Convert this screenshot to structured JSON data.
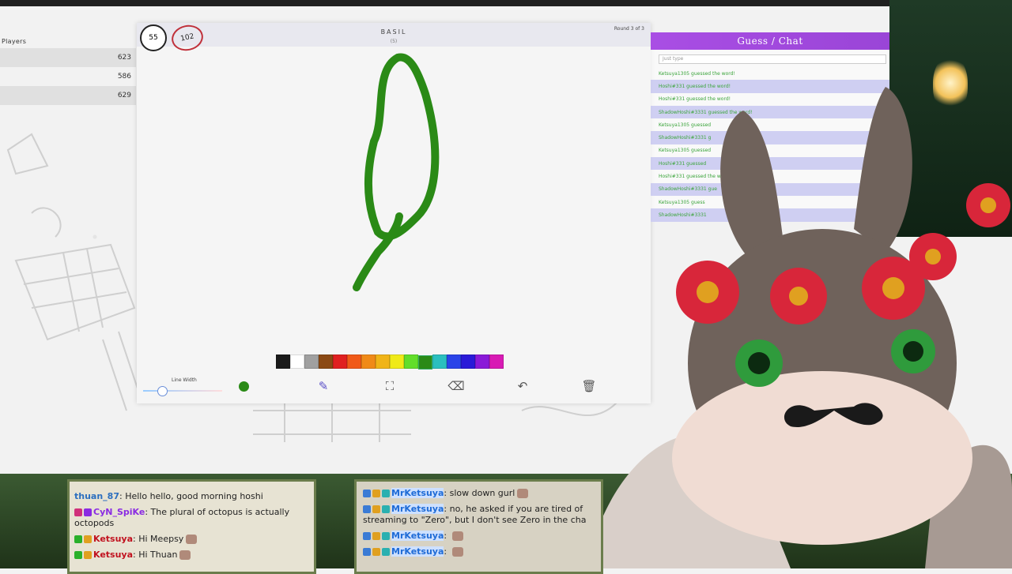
{
  "players": {
    "header": "Players",
    "rows": [
      {
        "score": "623"
      },
      {
        "score": "586"
      },
      {
        "score": "629"
      }
    ]
  },
  "game": {
    "timer": "55",
    "score_badge": "102",
    "word": "BASIL",
    "word_length": "(5)",
    "round": "Round 3 of 3",
    "line_width_label": "Line Width",
    "palette": [
      "#1a1a1a",
      "#ffffff",
      "#a0a0a0",
      "#8b4a14",
      "#e02020",
      "#f05a18",
      "#f08a18",
      "#f0b418",
      "#f0ea18",
      "#62de2a",
      "#2a8a16",
      "#2abfbf",
      "#2a44e8",
      "#2a1ad8",
      "#8a1ad8",
      "#d81ab4"
    ],
    "selected_color": "#2a8a16",
    "tools": [
      {
        "name": "pencil",
        "icon": "pencil-icon",
        "glyph": "✎"
      },
      {
        "name": "fill",
        "icon": "fill-bucket-icon",
        "glyph": "⛶"
      },
      {
        "name": "eraser",
        "icon": "eraser-icon",
        "glyph": "⌫"
      },
      {
        "name": "undo",
        "icon": "undo-icon",
        "glyph": "↶"
      },
      {
        "name": "clear",
        "icon": "trash-icon",
        "glyph": "🗑"
      }
    ]
  },
  "guess_chat": {
    "title": "Guess / Chat",
    "placeholder": "Just type",
    "lines": [
      "Ketsuya1305 guessed the word!",
      "Hoshi#331 guessed the word!",
      "Hoshi#331 guessed the word!",
      "ShadowHoshi#3331 guessed the word!",
      "Ketsuya1305 guessed",
      "ShadowHoshi#3331 g",
      "Ketsuya1305 guessed",
      "Hoshi#331 guessed",
      "Hoshi#331 guessed the w",
      "ShadowHoshi#3331 gue",
      "Ketsuya1305 guess",
      "ShadowHoshi#3331"
    ]
  },
  "chat_left": [
    {
      "user": "thuan_87",
      "text": "Hello hello, good morning hoshi",
      "cls": "u1"
    },
    {
      "user": "CyN_SpiKe",
      "text": "The plural of octopus is actually octopods",
      "cls": "u2"
    },
    {
      "user": "Ketsuya",
      "text": "Hi Meepsy",
      "cls": "u3"
    },
    {
      "user": "Ketsuya",
      "text": "Hi Thuan",
      "cls": "u3"
    }
  ],
  "chat_right": [
    {
      "user": "MrKetsuya",
      "text": "slow down gurl"
    },
    {
      "user": "MrKetsuya",
      "text": "no, he asked if you are tired of streaming to \"Zero\", but I don't see Zero in the cha"
    },
    {
      "user": "MrKetsuya",
      "text": ""
    },
    {
      "user": "MrKetsuya",
      "text": ""
    }
  ]
}
